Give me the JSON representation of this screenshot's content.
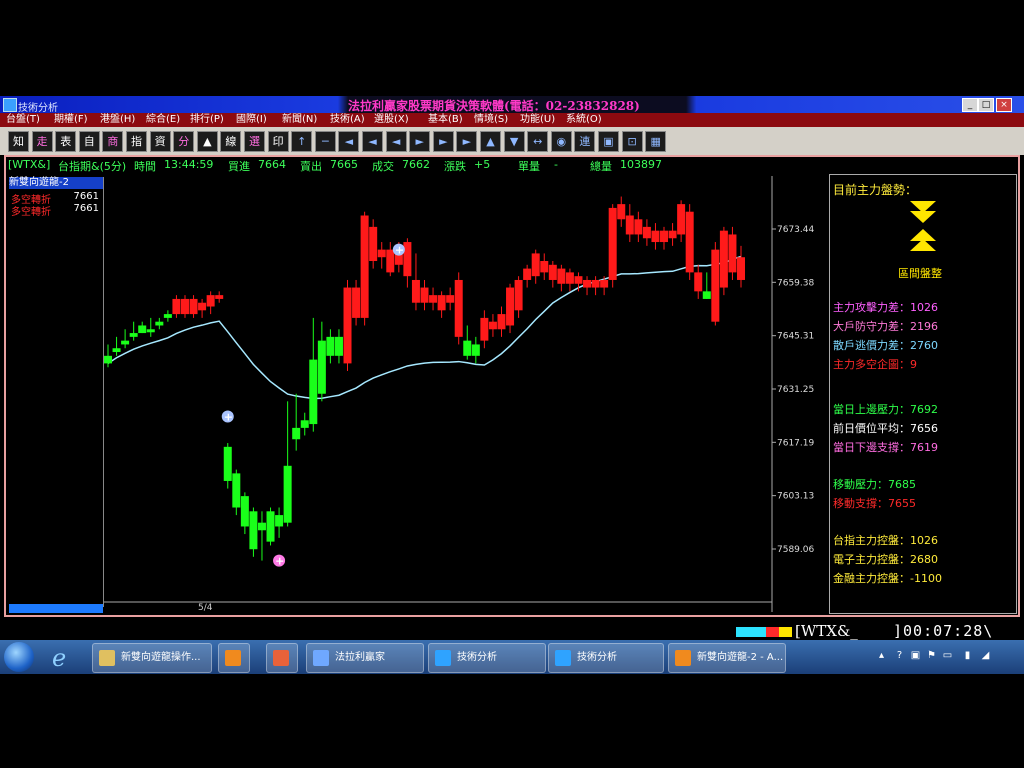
{
  "window": {
    "title": "技術分析",
    "banner": "法拉利贏家股票期貨決策軟體(電話：02-23832828)"
  },
  "menu": [
    "台盤(T)",
    "期權(F)",
    "港盤(H)",
    "綜合(E)",
    "排行(P)",
    "國際(I)",
    "新聞(N)",
    "技術(A)",
    "選股(X)",
    "基本(B)",
    "情境(S)",
    "功能(U)",
    "系統(O)"
  ],
  "toolbar": [
    "知",
    "走",
    "表",
    "自",
    "商",
    "指",
    "資",
    "分",
    "▲",
    "線",
    "選",
    "印",
    "↑",
    "─",
    "◄",
    "◄",
    "◄",
    "►",
    "►",
    "►",
    "▲",
    "▼",
    "↔",
    "◉",
    "連",
    "▣",
    "⊡",
    "▦"
  ],
  "info_bar": {
    "symbol": "[WTX&]",
    "name": "台指期&(5分)",
    "time_label": "時間",
    "time": "13:44:59",
    "bid_label": "買進",
    "bid": "7664",
    "ask_label": "賣出",
    "ask": "7665",
    "last_label": "成交",
    "last": "7662",
    "change_label": "漲跌",
    "change": "+5",
    "volume_label": "單量",
    "volume": "-",
    "total_label": "總量",
    "total": "103897"
  },
  "legend": {
    "title": "新雙向遊龍-2",
    "rows": [
      {
        "label": "多空轉折",
        "value": "7661"
      },
      {
        "label": "多空轉折",
        "value": "7661"
      }
    ]
  },
  "chart_data": {
    "type": "candlestick",
    "y_ticks": [
      "7673.44",
      "7659.38",
      "7645.31",
      "7631.25",
      "7617.19",
      "7603.13",
      "7589.06"
    ],
    "ylim": [
      7583,
      7690
    ],
    "x_label": "5/4",
    "up_color": "#ff1a1a",
    "down_color": "#1aff1a",
    "candles": [
      [
        7640,
        7643,
        7637,
        7638,
        "g"
      ],
      [
        7642,
        7645,
        7640,
        7641,
        "g"
      ],
      [
        7644,
        7647,
        7642,
        7643,
        "g"
      ],
      [
        7646,
        7649,
        7644,
        7645,
        "g"
      ],
      [
        7648,
        7649,
        7646,
        7646,
        "g"
      ],
      [
        7647,
        7650,
        7645,
        7647,
        "g"
      ],
      [
        7649,
        7650,
        7647,
        7648,
        "g"
      ],
      [
        7651,
        7652,
        7649,
        7650,
        "g"
      ],
      [
        7651,
        7656,
        7650,
        7655,
        "r"
      ],
      [
        7651,
        7656,
        7650,
        7655,
        "r"
      ],
      [
        7651,
        7656,
        7650,
        7655,
        "r"
      ],
      [
        7652,
        7655,
        7650,
        7654,
        "r"
      ],
      [
        7653,
        7657,
        7651,
        7656,
        "r"
      ],
      [
        7656,
        7657,
        7654,
        7655,
        "r"
      ],
      [
        7616,
        7617,
        7605,
        7607,
        "g"
      ],
      [
        7609,
        7610,
        7598,
        7600,
        "g"
      ],
      [
        7603,
        7604,
        7593,
        7595,
        "g"
      ],
      [
        7599,
        7600,
        7587,
        7589,
        "g"
      ],
      [
        7596,
        7599,
        7586,
        7594,
        "g"
      ],
      [
        7599,
        7600,
        7590,
        7591,
        "g"
      ],
      [
        7595,
        7600,
        7592,
        7598,
        "g"
      ],
      [
        7611,
        7628,
        7595,
        7596,
        "g"
      ],
      [
        7621,
        7630,
        7615,
        7618,
        "g"
      ],
      [
        7623,
        7625,
        7619,
        7621,
        "g"
      ],
      [
        7639,
        7650,
        7620,
        7622,
        "g"
      ],
      [
        7644,
        7649,
        7628,
        7630,
        "g"
      ],
      [
        7645,
        7647,
        7638,
        7640,
        "g"
      ],
      [
        7645,
        7647,
        7638,
        7640,
        "g"
      ],
      [
        7638,
        7660,
        7636,
        7658,
        "r"
      ],
      [
        7650,
        7660,
        7648,
        7658,
        "r"
      ],
      [
        7650,
        7678,
        7648,
        7677,
        "r"
      ],
      [
        7665,
        7676,
        7663,
        7674,
        "r"
      ],
      [
        7666,
        7670,
        7663,
        7668,
        "r"
      ],
      [
        7662,
        7670,
        7661,
        7668,
        "r"
      ],
      [
        7664,
        7670,
        7662,
        7668,
        "r"
      ],
      [
        7661,
        7671,
        7658,
        7670,
        "r"
      ],
      [
        7654,
        7667,
        7652,
        7660,
        "r"
      ],
      [
        7654,
        7660,
        7652,
        7658,
        "r"
      ],
      [
        7654,
        7658,
        7652,
        7656,
        "r"
      ],
      [
        7652,
        7657,
        7650,
        7656,
        "r"
      ],
      [
        7654,
        7658,
        7652,
        7656,
        "r"
      ],
      [
        7645,
        7662,
        7643,
        7660,
        "r"
      ],
      [
        7640,
        7648,
        7639,
        7644,
        "g"
      ],
      [
        7640,
        7645,
        7638,
        7643,
        "g"
      ],
      [
        7644,
        7652,
        7642,
        7650,
        "r"
      ],
      [
        7647,
        7651,
        7645,
        7649,
        "r"
      ],
      [
        7647,
        7653,
        7645,
        7651,
        "r"
      ],
      [
        7648,
        7659,
        7646,
        7658,
        "r"
      ],
      [
        7652,
        7661,
        7650,
        7660,
        "r"
      ],
      [
        7660,
        7664,
        7658,
        7663,
        "r"
      ],
      [
        7661,
        7668,
        7659,
        7667,
        "r"
      ],
      [
        7662,
        7667,
        7660,
        7665,
        "r"
      ],
      [
        7660,
        7665,
        7658,
        7664,
        "r"
      ],
      [
        7659,
        7664,
        7657,
        7663,
        "r"
      ],
      [
        7659,
        7663,
        7657,
        7662,
        "r"
      ],
      [
        7659,
        7662,
        7657,
        7661,
        "r"
      ],
      [
        7658,
        7661,
        7656,
        7660,
        "r"
      ],
      [
        7658,
        7661,
        7656,
        7660,
        "r"
      ],
      [
        7658,
        7661,
        7656,
        7660,
        "r"
      ],
      [
        7660,
        7680,
        7658,
        7679,
        "r"
      ],
      [
        7676,
        7682,
        7674,
        7680,
        "r"
      ],
      [
        7672,
        7680,
        7670,
        7677,
        "r"
      ],
      [
        7672,
        7678,
        7670,
        7676,
        "r"
      ],
      [
        7671,
        7676,
        7669,
        7674,
        "r"
      ],
      [
        7670,
        7675,
        7668,
        7673,
        "r"
      ],
      [
        7670,
        7674,
        7668,
        7673,
        "r"
      ],
      [
        7671,
        7675,
        7669,
        7673,
        "r"
      ],
      [
        7672,
        7681,
        7670,
        7680,
        "r"
      ],
      [
        7662,
        7680,
        7660,
        7678,
        "r"
      ],
      [
        7657,
        7664,
        7655,
        7662,
        "r"
      ],
      [
        7657,
        7662,
        7655,
        7655,
        "g"
      ],
      [
        7649,
        7670,
        7648,
        7668,
        "r"
      ],
      [
        7658,
        7674,
        7656,
        7673,
        "r"
      ],
      [
        7662,
        7674,
        7660,
        7672,
        "r"
      ],
      [
        7660,
        7669,
        7658,
        7666,
        "r"
      ]
    ],
    "markers": [
      {
        "i": 34,
        "price": 7668,
        "color": "#aac4ff"
      },
      {
        "i": 14,
        "price": 7624,
        "color": "#aac4ff"
      },
      {
        "i": 20,
        "price": 7586,
        "color": "#ff7ae6"
      }
    ]
  },
  "right_panel": {
    "title": "目前主力盤勢：",
    "trend_label": "區間盤整",
    "rows": [
      {
        "text": "主力攻擊力差：1026",
        "color": "#ff60ff"
      },
      {
        "text": "大戶防守力差：2196",
        "color": "#ff7ad8"
      },
      {
        "text": "散戶逃價力差：2760",
        "color": "#7dd8ff"
      },
      {
        "text": "主力多空企圖：9",
        "color": "#ff2a2a"
      },
      {
        "text": "當日上邊壓力：7692",
        "color": "#2eff4a"
      },
      {
        "text": "前日價位平均：7656",
        "color": "#ffffff"
      },
      {
        "text": "當日下邊支撐：7619",
        "color": "#ff6de0"
      },
      {
        "text": "移動壓力：7685",
        "color": "#2eff4a"
      },
      {
        "text": "移動支撐：7655",
        "color": "#ff2a2a"
      },
      {
        "text": "台指主力控盤：1026",
        "color": "#ffeb3b"
      },
      {
        "text": "電子主力控盤：2680",
        "color": "#ffeb3b"
      },
      {
        "text": "金融主力控盤：-1100",
        "color": "#ffeb3b"
      }
    ]
  },
  "status": {
    "code": "[WTX&_",
    "clock": "]00:07:28\\"
  },
  "taskbar": [
    {
      "label": "新雙向遊龍操作...",
      "color": "#e0c060"
    },
    {
      "label": "",
      "color": "#f08a1e"
    },
    {
      "label": "",
      "color": "#e8623a"
    },
    {
      "label": "法拉利贏家",
      "color": "#6fa8ff"
    },
    {
      "label": "技術分析",
      "color": "#2fa3ff"
    },
    {
      "label": "技術分析",
      "color": "#2fa3ff"
    },
    {
      "label": "新雙向遊龍-2 - A...",
      "color": "#f08a1e"
    }
  ],
  "tray_time": ""
}
